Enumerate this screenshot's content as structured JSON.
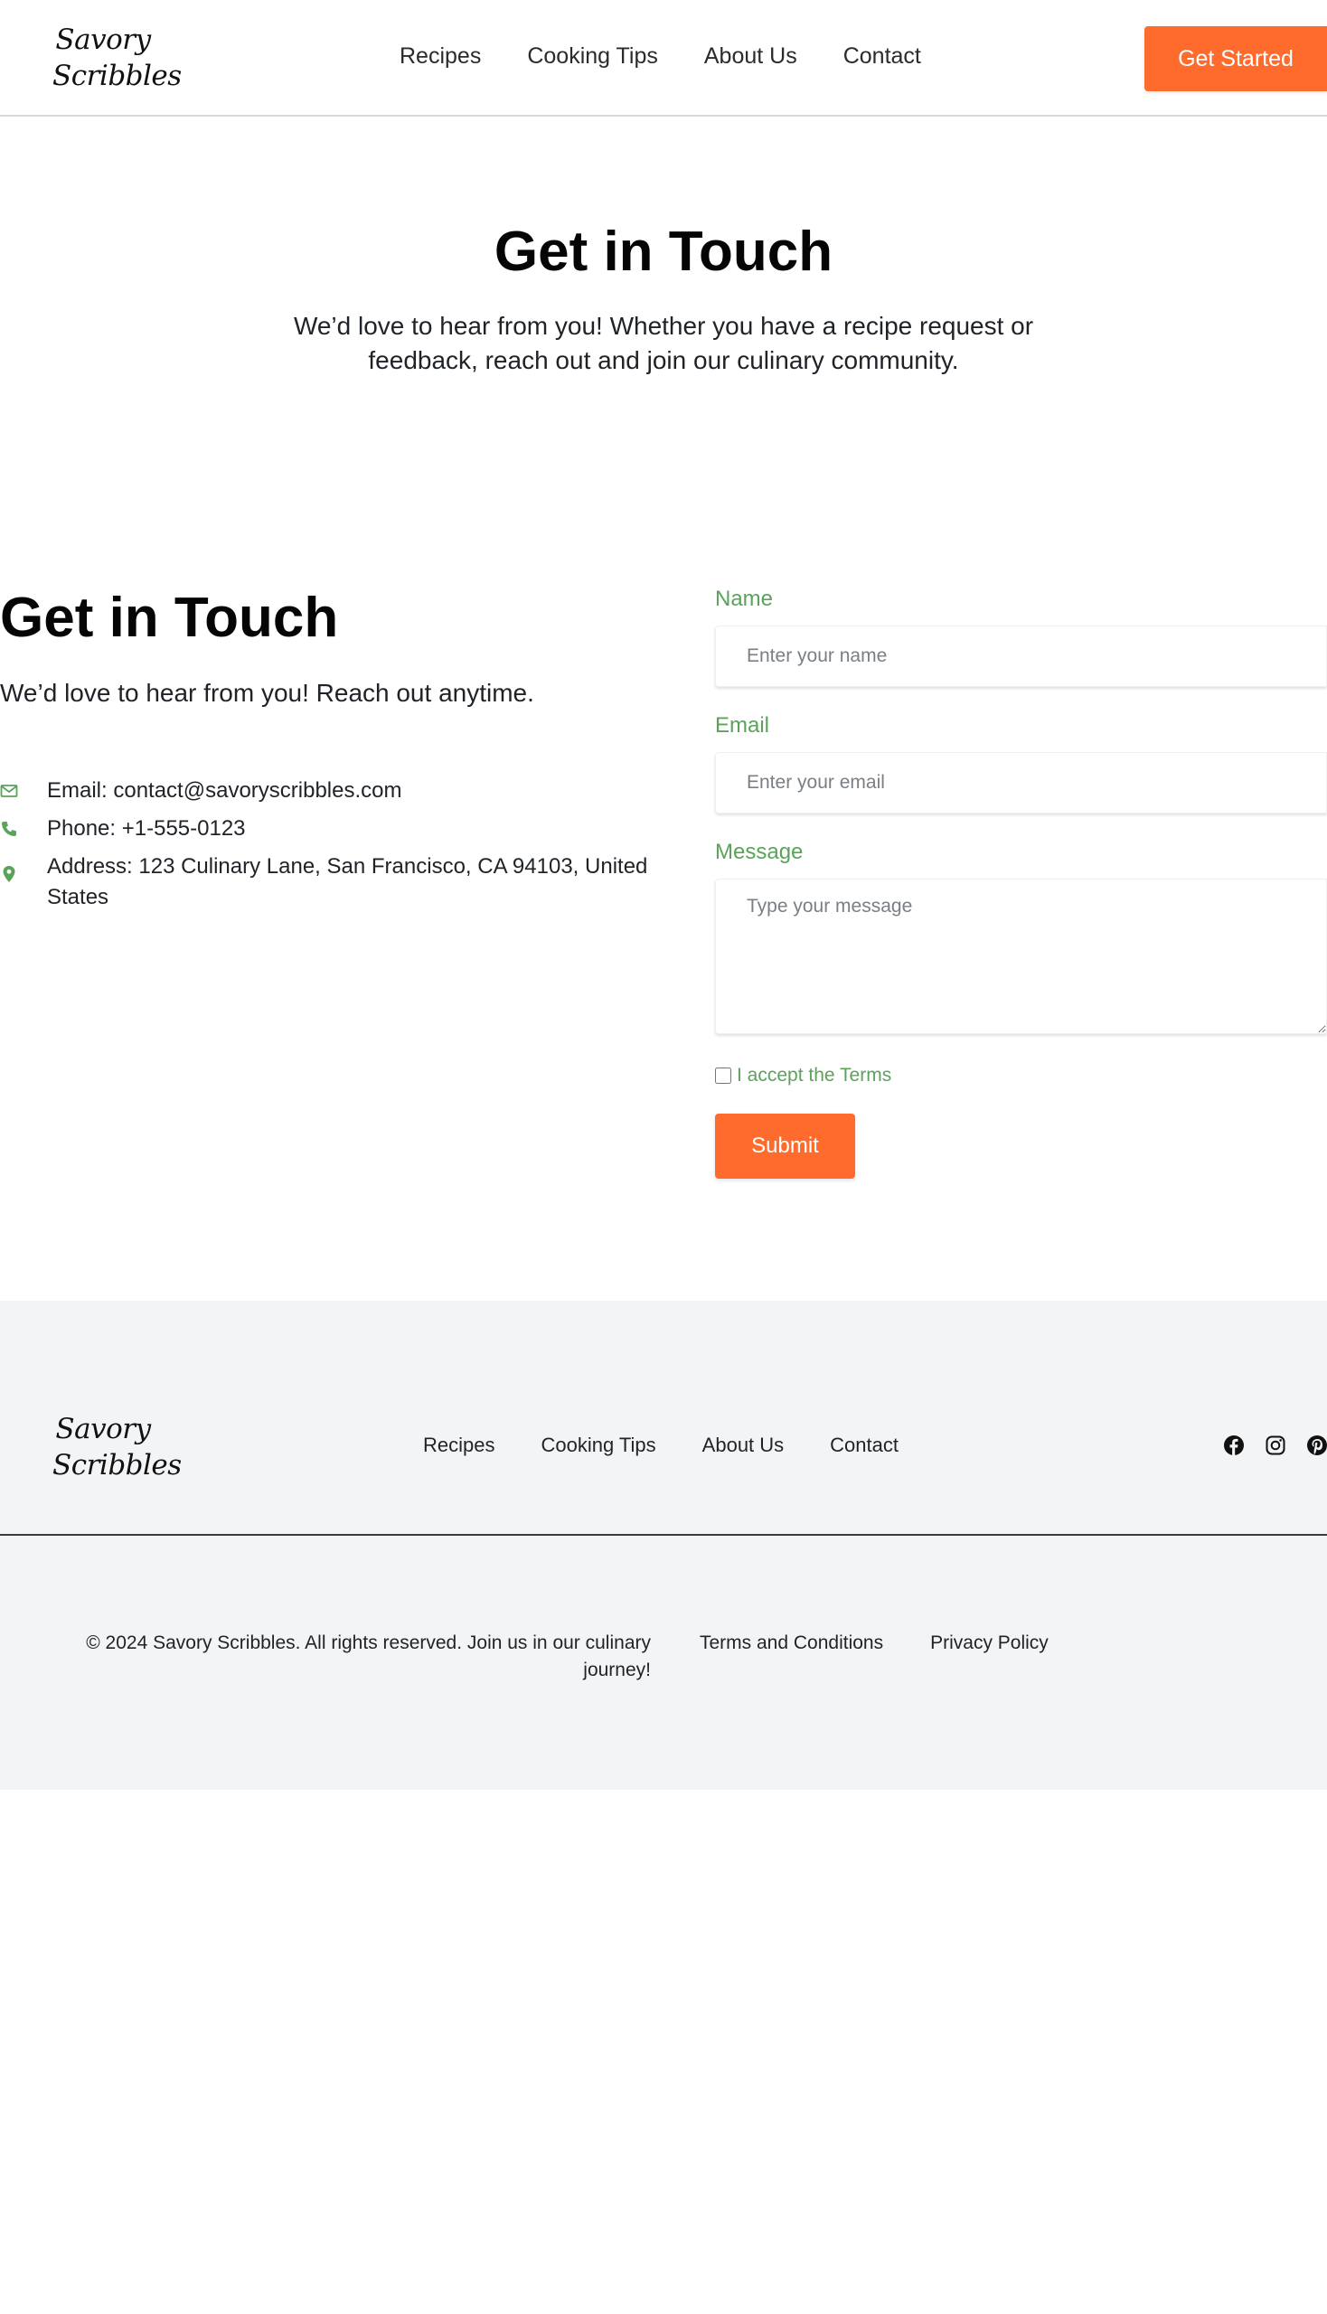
{
  "brand": {
    "logo_line1": "Savory",
    "logo_line2": "Scribbles"
  },
  "header": {
    "nav": [
      "Recipes",
      "Cooking Tips",
      "About Us",
      "Contact"
    ],
    "cta_label": "Get Started"
  },
  "hero": {
    "title": "Get in Touch",
    "subtitle": "We’d love to hear from you! Whether you have a recipe request or feedback, reach out and join our culinary community."
  },
  "contact": {
    "title": "Get in Touch",
    "subtitle": "We’d love to hear from you! Reach out anytime.",
    "email": "Email: contact@savoryscribbles.com",
    "phone": "Phone: +1-555-0123",
    "address": "Address: 123 Culinary Lane, San Francisco, CA 94103, United States",
    "icons": [
      "envelope-icon",
      "phone-icon",
      "map-pin-icon"
    ]
  },
  "form": {
    "name_label": "Name",
    "name_placeholder": "Enter your name",
    "email_label": "Email",
    "email_placeholder": "Enter your email",
    "message_label": "Message",
    "message_placeholder": "Type your message",
    "terms_label": "I accept the Terms",
    "submit_label": "Submit"
  },
  "footer": {
    "nav": [
      "Recipes",
      "Cooking Tips",
      "About Us",
      "Contact"
    ],
    "social": [
      "facebook-icon",
      "instagram-icon",
      "pinterest-icon"
    ],
    "copyright": "© 2024 Savory Scribbles. All rights reserved. Join us in our culinary journey!",
    "terms": "Terms and Conditions",
    "privacy": "Privacy Policy"
  },
  "colors": {
    "accent": "#ff6b2d",
    "label_green": "#5ba35b",
    "footer_bg": "#f3f4f6"
  }
}
